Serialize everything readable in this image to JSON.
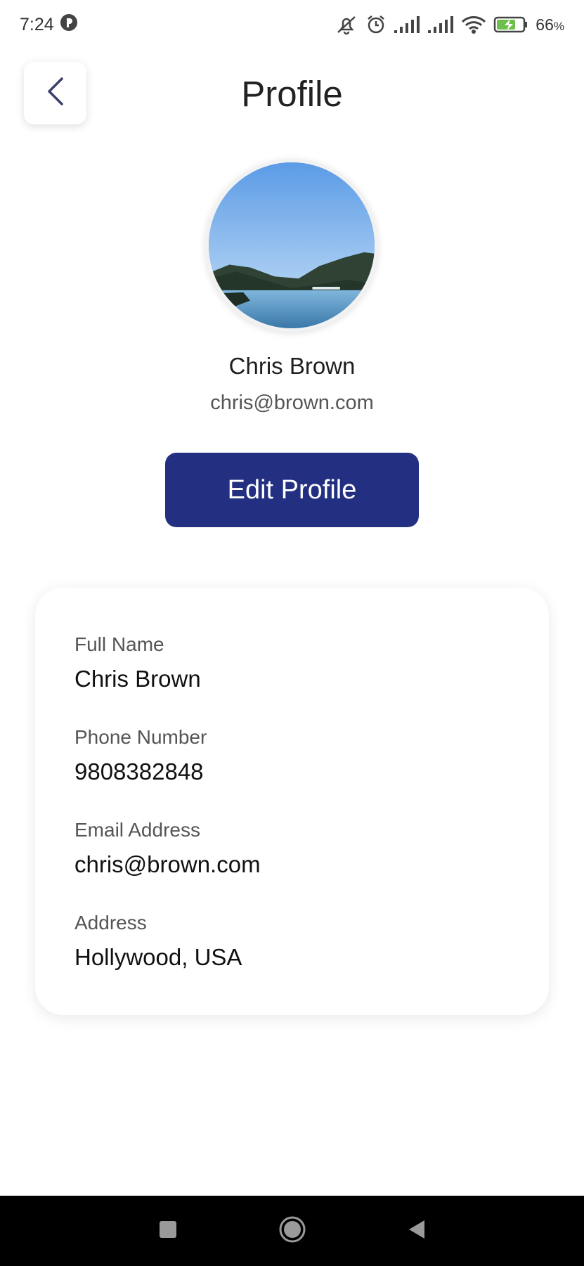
{
  "status_bar": {
    "time": "7:24",
    "battery_percent": "66",
    "battery_unit": "%",
    "icons": [
      "app-notification-icon",
      "mute-icon",
      "alarm-icon",
      "signal-icon",
      "signal-icon",
      "wifi-icon",
      "battery-charging-icon"
    ],
    "battery_color": "#6cc04a"
  },
  "header": {
    "title": "Profile",
    "back_icon": "chevron-left-icon"
  },
  "profile": {
    "name": "Chris Brown",
    "email": "chris@brown.com",
    "avatar": "landscape-lake-photo"
  },
  "actions": {
    "edit_label": "Edit Profile",
    "edit_color": "#232f81"
  },
  "details": {
    "fields": [
      {
        "label": "Full Name",
        "value": "Chris Brown"
      },
      {
        "label": "Phone Number",
        "value": "9808382848"
      },
      {
        "label": "Email Address",
        "value": "chris@brown.com"
      },
      {
        "label": "Address",
        "value": "Hollywood, USA"
      }
    ]
  },
  "nav": {
    "icons": [
      "recents-square-icon",
      "home-circle-icon",
      "back-triangle-icon"
    ]
  }
}
